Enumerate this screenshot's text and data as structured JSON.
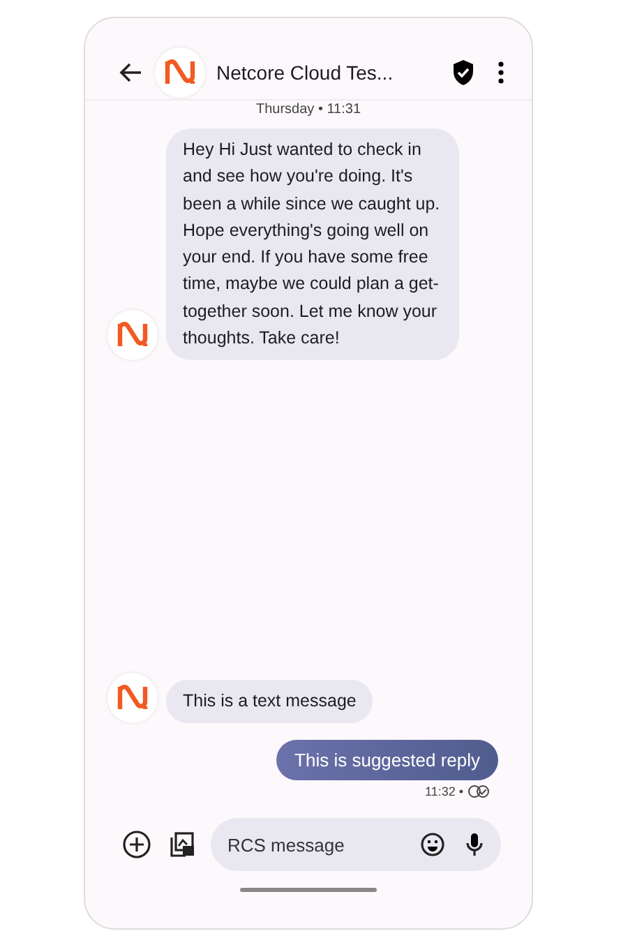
{
  "header": {
    "title": "Netcore Cloud Tes...",
    "verified": true
  },
  "date_label": "Thursday • 11:31",
  "messages": [
    {
      "kind": "incoming",
      "text": "Hey Hi Just wanted to check in and see how you're doing. It's been a while since we caught up. Hope everything's going well on your end. If you have some free time, maybe we could plan a get-together soon. Let me know your thoughts. Take care!"
    },
    {
      "kind": "incoming",
      "text": "This is a text message"
    },
    {
      "kind": "outgoing",
      "text": "This is suggested reply",
      "time": "11:32 •",
      "read": true
    }
  ],
  "composer": {
    "placeholder": "RCS message"
  }
}
